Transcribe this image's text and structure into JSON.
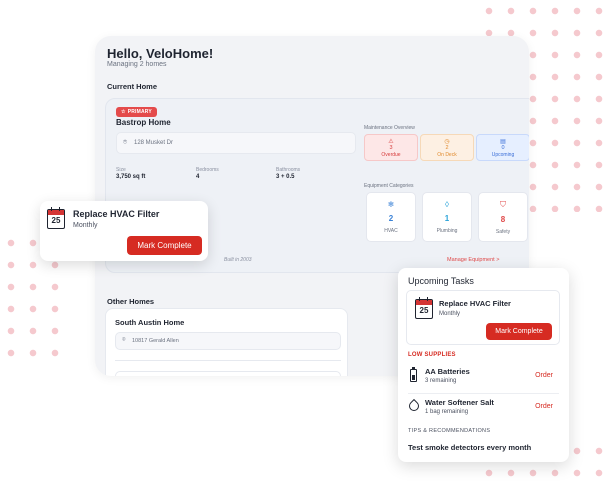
{
  "colors": {
    "accent": "#d62b22",
    "overdue": "#d63c3c",
    "on_deck": "#e08a2c",
    "upcoming": "#3b6fd8"
  },
  "app": {
    "greeting": "Hello, VeloHome!",
    "subtitle": "Managing 2 homes",
    "current_home_heading": "Current Home",
    "current_home": {
      "badge": "PRIMARY",
      "name": "Bastrop Home",
      "address": "128 Musket Dr",
      "stats": [
        {
          "label": "Size",
          "value": "3,750 sq ft"
        },
        {
          "label": "Bedrooms",
          "value": "4"
        },
        {
          "label": "Bathrooms",
          "value": "3 + 0.5"
        }
      ],
      "built": "Built in 2003"
    },
    "maintenance": {
      "title": "Maintenance Overview",
      "overdue": {
        "count": "3",
        "label": "Overdue"
      },
      "on_deck": {
        "count": "2",
        "label": "On Deck"
      },
      "upcoming": {
        "count": "0",
        "label": "Upcoming"
      }
    },
    "equipment": {
      "title": "Equipment Categories",
      "hvac": {
        "count": "2",
        "label": "HVAC",
        "icon": "snowflake-icon"
      },
      "plumbing": {
        "count": "1",
        "label": "Plumbing",
        "icon": "water-drop-icon"
      },
      "safety": {
        "count": "8",
        "label": "Safety",
        "icon": "shield-icon"
      },
      "manage_link": "Manage Equipment  >"
    },
    "other_homes_heading": "Other Homes",
    "other_home": {
      "name": "South Austin Home",
      "address": "10817 Gerald Allen"
    }
  },
  "popup": {
    "calendar_day": "25",
    "title": "Replace HVAC Filter",
    "frequency": "Monthly",
    "button": "Mark Complete"
  },
  "upcoming": {
    "title": "Upcoming Tasks",
    "task": {
      "calendar_day": "25",
      "title": "Replace HVAC Filter",
      "frequency": "Monthly",
      "button": "Mark Complete"
    },
    "low_supplies_label": "LOW SUPPLIES",
    "supplies": [
      {
        "name": "AA Batteries",
        "remaining": "3 remaining",
        "action": "Order",
        "icon": "battery-icon"
      },
      {
        "name": "Water Softener Salt",
        "remaining": "1 bag remaining",
        "action": "Order",
        "icon": "water-drop-icon"
      }
    ],
    "tips_label": "TIPS & RECOMMENDATIONS",
    "tip": "Test smoke detectors every month"
  }
}
